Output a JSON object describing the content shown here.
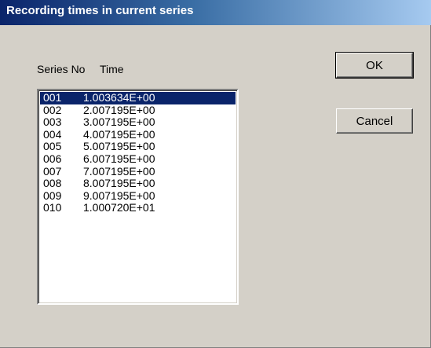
{
  "dialog": {
    "title": "Recording times in current series",
    "column_headers": {
      "series_no": "Series No",
      "time": "Time"
    },
    "rows": [
      {
        "num": "001",
        "time": "1.003634E+00",
        "selected": true
      },
      {
        "num": "002",
        "time": "2.007195E+00",
        "selected": false
      },
      {
        "num": "003",
        "time": "3.007195E+00",
        "selected": false
      },
      {
        "num": "004",
        "time": "4.007195E+00",
        "selected": false
      },
      {
        "num": "005",
        "time": "5.007195E+00",
        "selected": false
      },
      {
        "num": "006",
        "time": "6.007195E+00",
        "selected": false
      },
      {
        "num": "007",
        "time": "7.007195E+00",
        "selected": false
      },
      {
        "num": "008",
        "time": "8.007195E+00",
        "selected": false
      },
      {
        "num": "009",
        "time": "9.007195E+00",
        "selected": false
      },
      {
        "num": "010",
        "time": "1.000720E+01",
        "selected": false
      }
    ],
    "buttons": {
      "ok": "OK",
      "cancel": "Cancel"
    }
  },
  "colors": {
    "dialog_face": "#d4d0c8",
    "title_gradient_start": "#0a246a",
    "title_gradient_end": "#a6caf0",
    "selection": "#0a246a"
  }
}
